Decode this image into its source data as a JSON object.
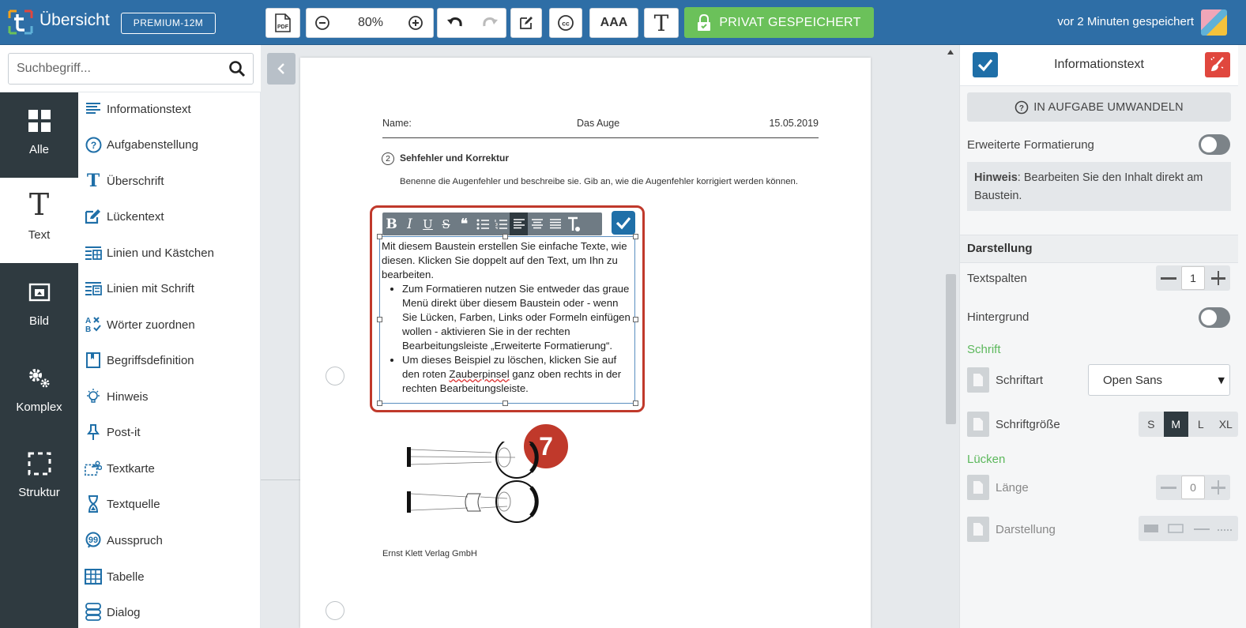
{
  "topbar": {
    "title": "Übersicht",
    "plan": "PREMIUM-12M",
    "pdf_label": "PDF",
    "zoom": "80%",
    "font_size_label": "AAA",
    "text_label": "T",
    "private_button": "PRIVAT GESPEICHERT",
    "saved_status": "vor 2 Minuten gespeichert",
    "accent": "#2e6ea6",
    "private_color": "#6bc15a"
  },
  "search": {
    "placeholder": "Suchbegriff..."
  },
  "categories": [
    {
      "label": "Alle",
      "icon": "grid-icon"
    },
    {
      "label": "Text",
      "icon": "text-t-icon"
    },
    {
      "label": "Bild",
      "icon": "image-icon"
    },
    {
      "label": "Komplex",
      "icon": "gears-icon"
    },
    {
      "label": "Struktur",
      "icon": "dashed-square-icon"
    }
  ],
  "active_category": "Text",
  "blocks": [
    {
      "label": "Informationstext",
      "icon": "lines-icon"
    },
    {
      "label": "Aufgabenstellung",
      "icon": "question-circle-icon"
    },
    {
      "label": "Überschrift",
      "icon": "heading-t-icon"
    },
    {
      "label": "Lückentext",
      "icon": "edit-box-icon"
    },
    {
      "label": "Linien und Kästchen",
      "icon": "lines-boxes-icon"
    },
    {
      "label": "Linien mit Schrift",
      "icon": "lines-text-icon"
    },
    {
      "label": "Wörter zuordnen",
      "icon": "match-words-icon"
    },
    {
      "label": "Begriffsdefinition",
      "icon": "definition-icon"
    },
    {
      "label": "Hinweis",
      "icon": "lightbulb-icon"
    },
    {
      "label": "Post-it",
      "icon": "pin-icon"
    },
    {
      "label": "Textkarte",
      "icon": "scissors-card-icon"
    },
    {
      "label": "Textquelle",
      "icon": "hourglass-icon"
    },
    {
      "label": "Ausspruch",
      "icon": "quote-bubble-icon"
    },
    {
      "label": "Tabelle",
      "icon": "table-icon"
    },
    {
      "label": "Dialog",
      "icon": "dialog-icon"
    }
  ],
  "document": {
    "name_label": "Name:",
    "title": "Das Auge",
    "date": "15.05.2019",
    "task_number": "2",
    "task_title": "Sehfehler und Korrektur",
    "instruction": "Benenne die Augenfehler und beschreibe sie. Gib an, wie die Augenfehler korrigiert werden können.",
    "text_block": {
      "paragraph": "Mit diesem Baustein erstellen Sie einfache Texte, wie diesen. Klicken Sie doppelt auf den Text, um Ihn zu bearbeiten.",
      "bullet1": "Zum Formatieren nutzen Sie entweder das graue Menü direkt über diesem Baustein oder - wenn Sie Lücken, Farben, Links oder Formeln einfügen wollen - aktivieren Sie in der rechten Bearbeitungsleiste „Erweiterte Formatierung“.",
      "bullet2_pre": "Um dieses Beispiel zu löschen, klicken Sie auf den roten ",
      "bullet2_link": "Zauberpinsel",
      "bullet2_post": " ganz oben rechts in der rechten Bearbeitungsleiste."
    },
    "copyright": "Ernst Klett Verlag GmbH",
    "step_marker": "7"
  },
  "format_toolbar": {
    "bold": "B",
    "italic": "I",
    "underline": "U",
    "strike": "S",
    "quote": "❝",
    "active": "align-left"
  },
  "right_panel": {
    "title": "Informationstext",
    "convert_button": "IN AUFGABE UMWANDELN",
    "extended_format_label": "Erweiterte Formatierung",
    "extended_format_on": false,
    "hint_bold": "Hinweis",
    "hint_text": ": Bearbeiten Sie den Inhalt direkt am Baustein.",
    "section_title": "Darstellung",
    "columns_label": "Textspalten",
    "columns_value": "1",
    "background_label": "Hintergrund",
    "background_on": false,
    "font_group": "Schrift",
    "font_family_label": "Schriftart",
    "font_family_value": "Open Sans",
    "font_size_label": "Schriftgröße",
    "font_sizes": [
      "S",
      "M",
      "L",
      "XL"
    ],
    "font_size_selected": "M",
    "gaps_group": "Lücken",
    "length_label": "Länge",
    "length_value": "0",
    "display_label": "Darstellung",
    "group_color": "#5cb85c",
    "delete_color": "#e0473e"
  }
}
